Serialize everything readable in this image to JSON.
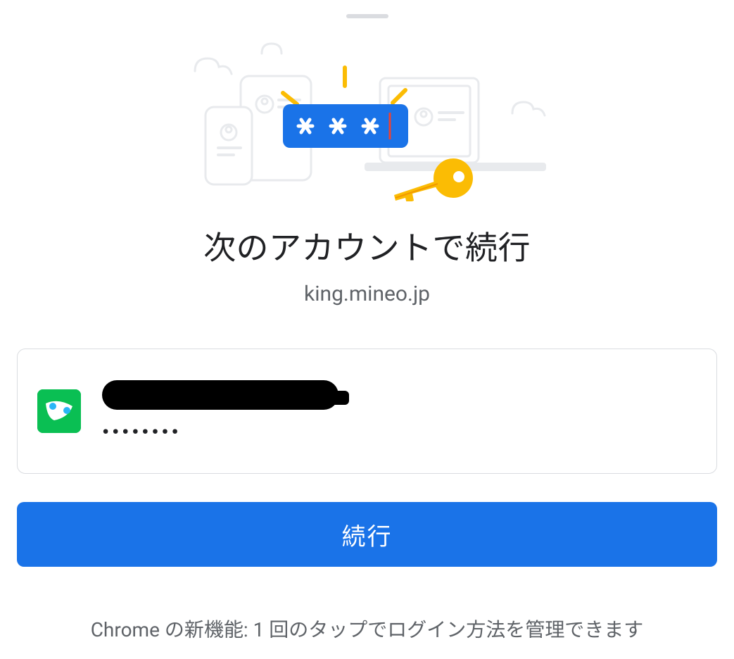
{
  "dialog": {
    "heading": "次のアカウントで続行",
    "domain": "king.mineo.jp",
    "account": {
      "password_mask": "••••••••"
    },
    "continue_label": "続行",
    "footer": "Chrome の新機能: 1 回のタップでログイン方法を管理できます"
  }
}
